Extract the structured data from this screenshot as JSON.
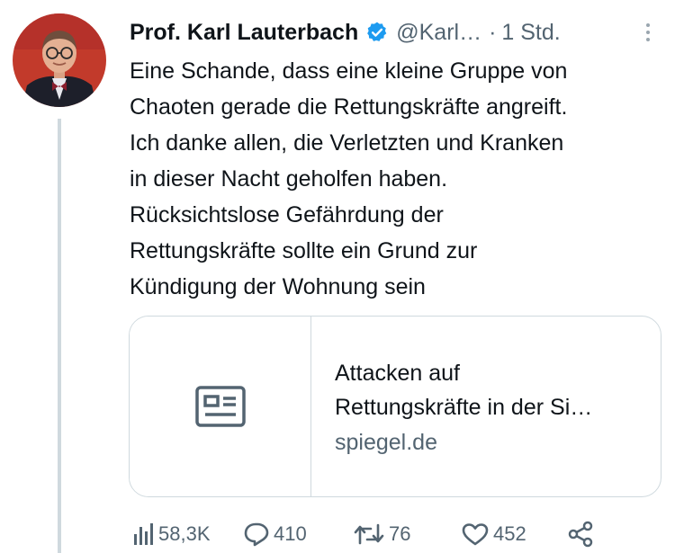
{
  "author": {
    "display_name": "Prof. Karl Lauterbach",
    "handle": "@Karl…",
    "separator": "·",
    "time": "1 Std.",
    "verified": true,
    "avatar_icon": "profile-photo"
  },
  "tweet": {
    "lines": [
      "Eine Schande, dass eine kleine Gruppe von",
      "Chaoten gerade die Rettungskräfte angreift.",
      "Ich danke allen, die Verletzten und Kranken",
      "in dieser Nacht geholfen haben.",
      "Rücksichtslose Gefährdung der",
      "Rettungskräfte sollte  ein Grund zur",
      "Kündigung der Wohnung sein"
    ]
  },
  "link_card": {
    "thumb_icon": "article-icon",
    "title_lines": [
      "Attacken auf",
      "Rettungskräfte in der Si…"
    ],
    "domain": "spiegel.de"
  },
  "actions": {
    "views": "58,3K",
    "replies": "410",
    "retweets": "76",
    "likes": "452",
    "icons": [
      "views-icon",
      "reply-icon",
      "retweet-icon",
      "like-icon",
      "share-icon"
    ]
  },
  "colors": {
    "text": "#0f1419",
    "secondary": "#536471",
    "border": "#cfd9de",
    "verified": "#1d9bf0",
    "avatar_bg": "#c23a2b"
  }
}
